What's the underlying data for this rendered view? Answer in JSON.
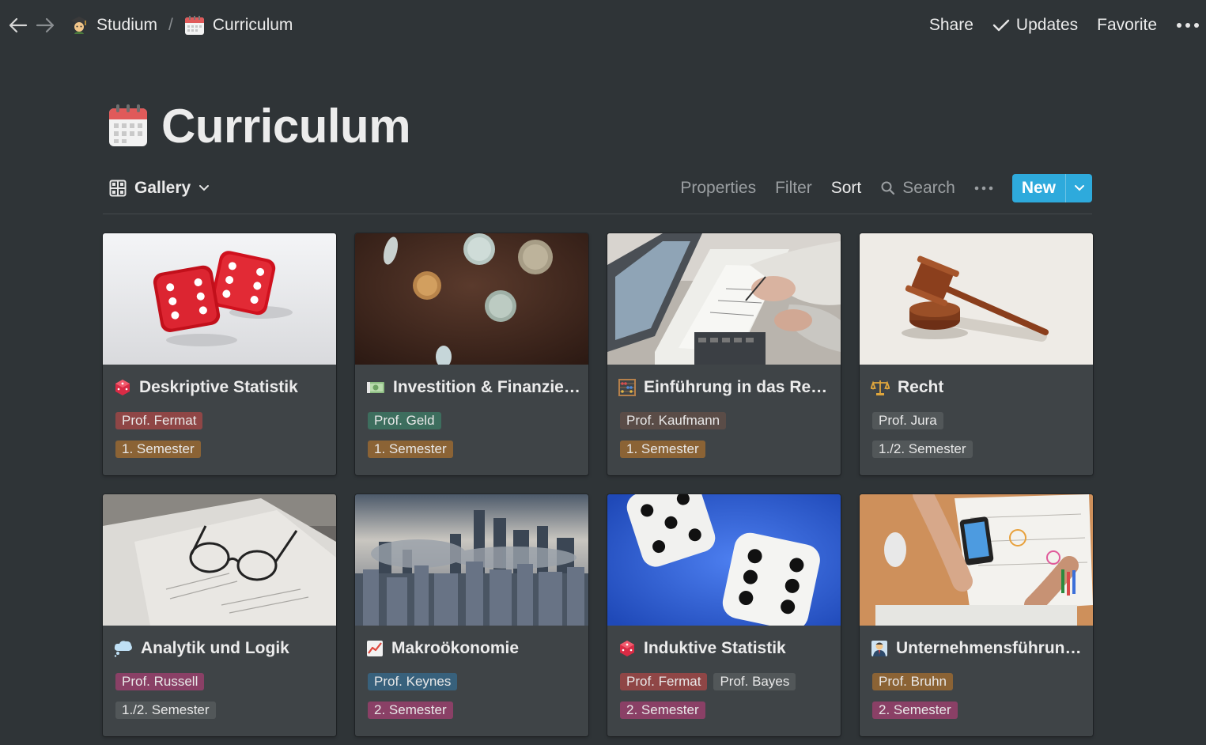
{
  "topbar": {
    "breadcrumb": [
      {
        "label": "Studium",
        "icon": "student-icon"
      },
      {
        "label": "Curriculum",
        "icon": "calendar-icon"
      }
    ],
    "separator": "/",
    "share_label": "Share",
    "updates_label": "Updates",
    "favorite_label": "Favorite"
  },
  "page": {
    "title": "Curriculum",
    "icon": "calendar-icon"
  },
  "toolbar": {
    "view_label": "Gallery",
    "properties_label": "Properties",
    "filter_label": "Filter",
    "sort_label": "Sort",
    "search_label": "Search",
    "new_label": "New",
    "accent": "#2eaadc"
  },
  "cards": [
    {
      "title": "Deskriptive Statistik",
      "icon": "die-icon",
      "profs": [
        "Prof. Fermat"
      ],
      "semester": "1. Semester"
    },
    {
      "title": "Investition & Finanzier...",
      "icon": "banknote-icon",
      "profs": [
        "Prof. Geld"
      ],
      "semester": "1. Semester"
    },
    {
      "title": "Einführung in das Rec...",
      "icon": "abacus-icon",
      "profs": [
        "Prof. Kaufmann"
      ],
      "semester": "1. Semester"
    },
    {
      "title": "Recht",
      "icon": "scales-icon",
      "profs": [
        "Prof. Jura"
      ],
      "semester": "1./2. Semester"
    },
    {
      "title": "Analytik und Logik",
      "icon": "thought-bubble-icon",
      "profs": [
        "Prof. Russell"
      ],
      "semester": "1./2. Semester"
    },
    {
      "title": "Makroökonomie",
      "icon": "chart-up-icon",
      "profs": [
        "Prof. Keynes"
      ],
      "semester": "2. Semester"
    },
    {
      "title": "Induktive Statistik",
      "icon": "die-icon",
      "profs": [
        "Prof. Fermat",
        "Prof. Bayes"
      ],
      "semester": "2. Semester"
    },
    {
      "title": "Unternehmensführung...",
      "icon": "businessman-icon",
      "profs": [
        "Prof. Bruhn"
      ],
      "semester": "2. Semester"
    }
  ]
}
